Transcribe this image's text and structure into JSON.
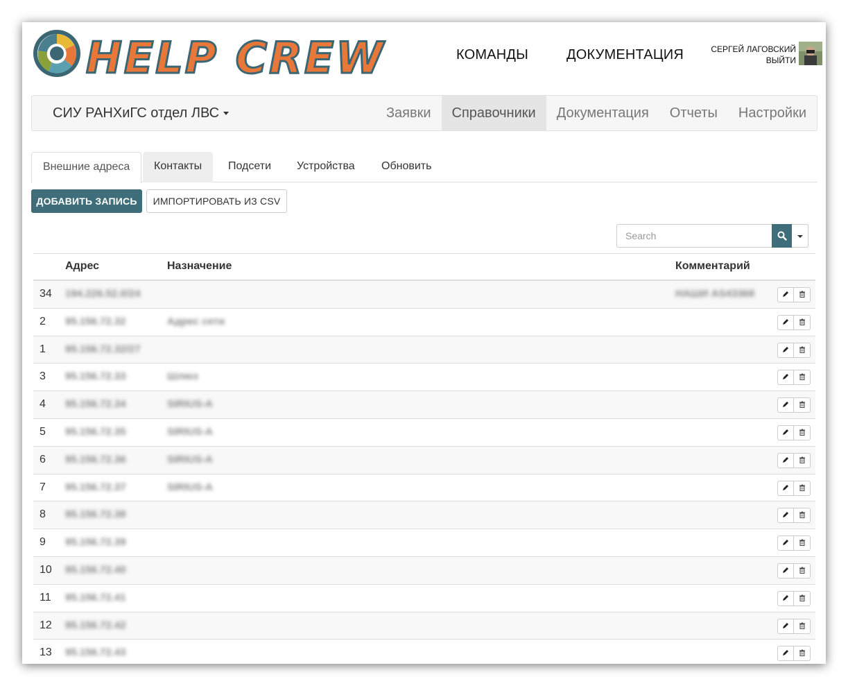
{
  "header": {
    "logo_text": "HELP CREW",
    "nav": [
      "КОМАНДЫ",
      "ДОКУМЕНТАЦИЯ"
    ],
    "user_name": "СЕРГЕЙ ЛАГОВСКИЙ",
    "logout": "ВЫЙТИ"
  },
  "navbar": {
    "org": "СИУ РАНХиГС отдел ЛВС",
    "items": [
      {
        "label": "Заявки",
        "active": false
      },
      {
        "label": "Справочники",
        "active": true
      },
      {
        "label": "Документация",
        "active": false
      },
      {
        "label": "Отчеты",
        "active": false
      },
      {
        "label": "Настройки",
        "active": false
      }
    ]
  },
  "tabs": [
    {
      "label": "Внешние адреса",
      "active": true
    },
    {
      "label": "Контакты",
      "active": false
    },
    {
      "label": "Подсети",
      "active": false
    },
    {
      "label": "Устройства",
      "active": false
    },
    {
      "label": "Обновить",
      "active": false
    }
  ],
  "buttons": {
    "add": "ДОБАВИТЬ ЗАПИСЬ",
    "import": "ИМПОРТИРОВАТЬ ИЗ CSV"
  },
  "search": {
    "placeholder": "Search"
  },
  "table": {
    "headers": {
      "address": "Адрес",
      "purpose": "Назначение",
      "comment": "Комментарий"
    },
    "rows": [
      {
        "num": "34",
        "address": "194.226.52.0/24",
        "purpose": "",
        "comment": "НАШИ AS43368"
      },
      {
        "num": "2",
        "address": "95.156.72.32",
        "purpose": "Адрес сети",
        "comment": ""
      },
      {
        "num": "1",
        "address": "95.156.72.32/27",
        "purpose": "",
        "comment": ""
      },
      {
        "num": "3",
        "address": "95.156.72.33",
        "purpose": "Шлюз",
        "comment": ""
      },
      {
        "num": "4",
        "address": "95.156.72.34",
        "purpose": "SIRIUS-A",
        "comment": ""
      },
      {
        "num": "5",
        "address": "95.156.72.35",
        "purpose": "SIRIUS-A",
        "comment": ""
      },
      {
        "num": "6",
        "address": "95.156.72.36",
        "purpose": "SIRIUS-A",
        "comment": ""
      },
      {
        "num": "7",
        "address": "95.156.72.37",
        "purpose": "SIRIUS-A",
        "comment": ""
      },
      {
        "num": "8",
        "address": "95.156.72.38",
        "purpose": "",
        "comment": ""
      },
      {
        "num": "9",
        "address": "95.156.72.39",
        "purpose": "",
        "comment": ""
      },
      {
        "num": "10",
        "address": "95.156.72.40",
        "purpose": "",
        "comment": ""
      },
      {
        "num": "11",
        "address": "95.156.72.41",
        "purpose": "",
        "comment": ""
      },
      {
        "num": "12",
        "address": "95.156.72.42",
        "purpose": "",
        "comment": ""
      },
      {
        "num": "13",
        "address": "95.156.72.43",
        "purpose": "",
        "comment": ""
      }
    ]
  },
  "colors": {
    "accent": "#3f6e7a",
    "logo_orange": "#e8773a",
    "logo_teal": "#3b6673"
  }
}
